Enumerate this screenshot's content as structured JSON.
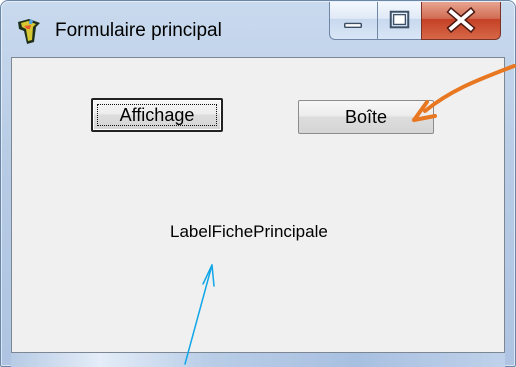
{
  "window": {
    "title": "Formulaire principal"
  },
  "controls": {
    "minimize_icon": "minimize-icon",
    "maximize_icon": "maximize-icon",
    "close_icon": "close-icon"
  },
  "form": {
    "buttons": {
      "affichage": "Affichage",
      "boite": "Boîte"
    },
    "label": "LabelFichePrincipale"
  },
  "colors": {
    "orange_arrow": "#e87722",
    "blue_arrow": "#12a7e8",
    "close_button": "#c54025",
    "form_background": "#f0f0f0"
  }
}
